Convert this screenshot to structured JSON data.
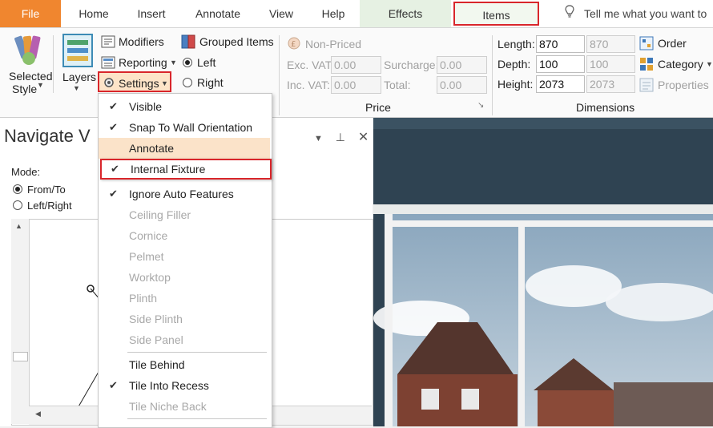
{
  "tabs": {
    "file": "File",
    "home": "Home",
    "insert": "Insert",
    "annotate": "Annotate",
    "view": "View",
    "help": "Help",
    "effects": "Effects",
    "items": "Items",
    "tell_me": "Tell me what you want to"
  },
  "ribbon": {
    "selected_style_1": "Selected",
    "selected_style_2": "Style",
    "layers": "Layers",
    "modifiers": "Modifiers",
    "reporting": "Reporting",
    "settings": "Settings",
    "grouped_items": "Grouped Items",
    "left": "Left",
    "right": "Right",
    "non_priced": "Non-Priced",
    "exc_vat_label": "Exc. VAT:",
    "exc_vat_value": "0.00",
    "inc_vat_label": "Inc. VAT:",
    "inc_vat_value": "0.00",
    "surcharge_label": "Surcharge:",
    "surcharge_value": "0.00",
    "total_label": "Total:",
    "total_value": "0.00",
    "price_group": "Price",
    "length_label": "Length:",
    "length_value": "870",
    "length_readonly": "870",
    "depth_label": "Depth:",
    "depth_value": "100",
    "depth_readonly": "100",
    "height_label": "Height:",
    "height_value": "2073",
    "height_readonly": "2073",
    "dimensions_group": "Dimensions",
    "order": "Order",
    "category": "Category",
    "properties": "Properties"
  },
  "left_panel": {
    "title": "Navigate V",
    "mode_label": "Mode:",
    "from_to": "From/To",
    "left_right": "Left/Right"
  },
  "menu": {
    "items": [
      {
        "label": "Visible",
        "checked": true,
        "disabled": false
      },
      {
        "label": "Snap To Wall Orientation",
        "checked": true,
        "disabled": false
      },
      {
        "label": "Annotate",
        "checked": false,
        "disabled": false
      },
      {
        "label": "Internal Fixture",
        "checked": true,
        "disabled": false
      },
      {
        "label": "Ignore Auto Features",
        "checked": true,
        "disabled": false
      },
      {
        "label": "Ceiling Filler",
        "checked": false,
        "disabled": true
      },
      {
        "label": "Cornice",
        "checked": false,
        "disabled": true
      },
      {
        "label": "Pelmet",
        "checked": false,
        "disabled": true
      },
      {
        "label": "Worktop",
        "checked": false,
        "disabled": true
      },
      {
        "label": "Plinth",
        "checked": false,
        "disabled": true
      },
      {
        "label": "Side Plinth",
        "checked": false,
        "disabled": true
      },
      {
        "label": "Side Panel",
        "checked": false,
        "disabled": true
      },
      {
        "label": "Tile Behind",
        "checked": false,
        "disabled": false
      },
      {
        "label": "Tile Into Recess",
        "checked": true,
        "disabled": false
      },
      {
        "label": "Tile Niche Back",
        "checked": false,
        "disabled": true
      }
    ]
  },
  "colors": {
    "file_tab": "#f0862f",
    "highlight_border": "#d9262b",
    "menu_hover": "#fbe3c9"
  }
}
